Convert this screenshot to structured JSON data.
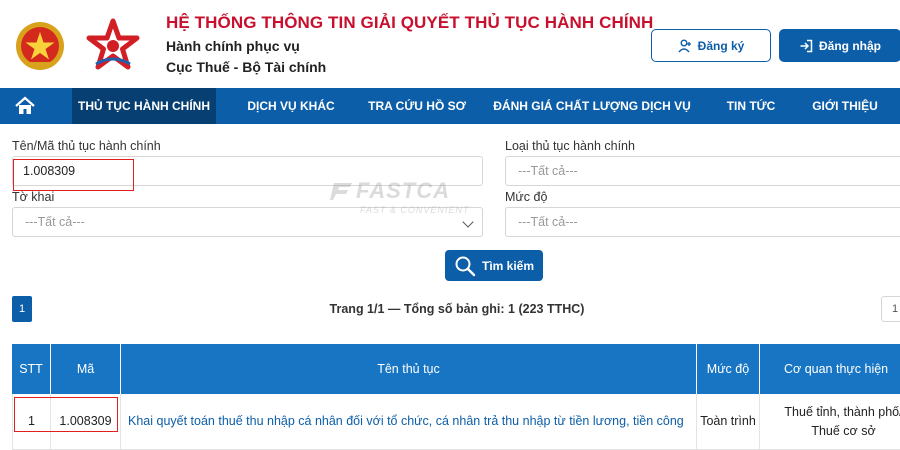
{
  "header": {
    "title": "HỆ THỐNG THÔNG TIN GIẢI QUYẾT THỦ TỤC HÀNH CHÍNH",
    "subtitle_line1": "Hành chính phục vụ",
    "subtitle_line2": "Cục Thuế - Bộ Tài chính",
    "register_label": "Đăng ký",
    "login_label": "Đăng nhập",
    "emblem_icon": "national-emblem-icon",
    "logo_icon": "red-star-logo-icon"
  },
  "nav": {
    "home_icon": "home-icon",
    "items": [
      {
        "label": "THỦ TỤC HÀNH CHÍNH",
        "active": true
      },
      {
        "label": "DỊCH VỤ KHÁC",
        "active": false
      },
      {
        "label": "TRA CỨU HỒ SƠ",
        "active": false
      },
      {
        "label": "ĐÁNH GIÁ CHẤT LƯỢNG DỊCH VỤ",
        "active": false
      },
      {
        "label": "TIN TỨC",
        "active": false
      },
      {
        "label": "GIỚI THIỆU",
        "active": false
      }
    ]
  },
  "form": {
    "name_code_label": "Tên/Mã thủ tục hành chính",
    "name_code_value": "1.008309",
    "procedure_type_label": "Loại thủ tục hành chính",
    "procedure_type_value": "---Tất cả---",
    "form_label": "Tờ khai",
    "form_value": "---Tất cả---",
    "level_label": "Mức độ",
    "level_value": "---Tất cả---",
    "search_label": "Tìm kiếm"
  },
  "watermark": {
    "brand": "FASTCA",
    "tagline": "FAST & CONVENIENT"
  },
  "pagination": {
    "current_page": "1",
    "info": "Trang 1/1 — Tổng số bản ghi: 1 (223 TTHC)",
    "right_box": "1"
  },
  "table": {
    "headers": [
      "STT",
      "Mã",
      "Tên thủ tục",
      "Mức độ",
      "Cơ quan thực hiện"
    ],
    "rows": [
      {
        "stt": "1",
        "code": "1.008309",
        "name": "Khai quyết toán thuế thu nhập cá nhân đối với tổ chức, cá nhân trả thu nhập từ tiền lương, tiền công",
        "level": "Toàn trình",
        "agency": "Thuế tỉnh, thành phố/ Thuế cơ sở"
      }
    ]
  },
  "colors": {
    "brand_blue": "#0d5ea8",
    "nav_active": "#073f73",
    "table_header": "#1775c4",
    "title_red": "#c8102e",
    "highlight_red": "#e02020"
  }
}
